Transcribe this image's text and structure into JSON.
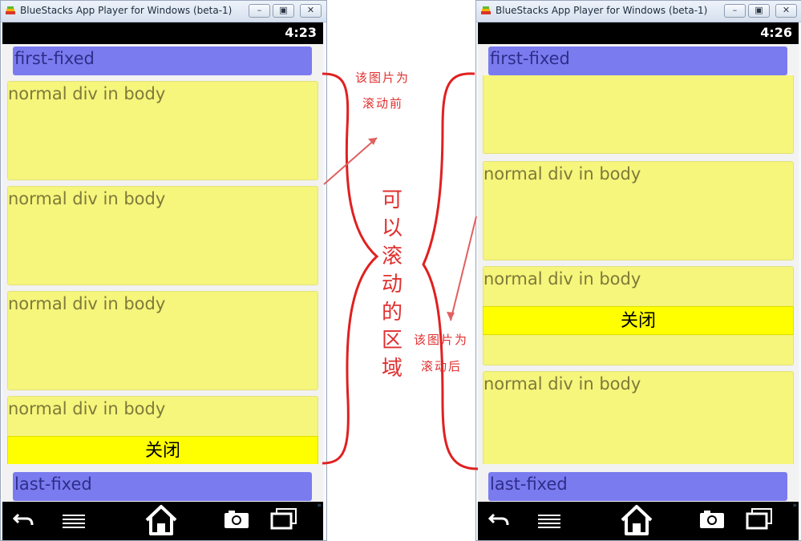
{
  "window_title": "BlueStacks App Player for Windows (beta-1)",
  "left": {
    "time": "4:23",
    "first_fixed": "first-fixed",
    "normal_div": "normal div in body",
    "close_label": "关闭",
    "last_fixed": "last-fixed"
  },
  "right": {
    "time": "4:26",
    "first_fixed": "first-fixed",
    "normal_div": "normal div in body",
    "close_label": "关闭",
    "last_fixed": "last-fixed"
  },
  "annotations": {
    "before_line1": "该图片为",
    "before_line2": "滚动前",
    "scrollable_area": "可以滚动的区域",
    "after_line1": "该图片为",
    "after_line2": "滚动后"
  },
  "colors": {
    "fixed_bar": "#7b7bf0",
    "normal_div": "#f6f57c",
    "close_button": "#ffff00",
    "annotation": "#e03030"
  },
  "icons": [
    "bluestacks-logo-icon",
    "minimize-icon",
    "maximize-icon",
    "close-icon",
    "back-icon",
    "menu-icon",
    "home-icon",
    "camera-icon",
    "recent-apps-icon",
    "more-icon"
  ]
}
